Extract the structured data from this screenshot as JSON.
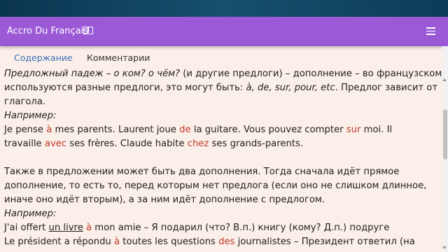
{
  "app": {
    "title": "Accro Du Français"
  },
  "tabs": [
    {
      "label": "Содержание"
    },
    {
      "label": "Комментарии"
    }
  ],
  "content": {
    "p1_a": "Предложный падеж – о ком? о чём?",
    "p1_b": " (и другие предлоги) – дополнение – во французском",
    "p2_a": "используются разные предлоги, это могут быть: ",
    "p2_b": "à, de, sur, pour, etc",
    "p2_c": ". Предлог зависит от",
    "p3": "глагола.",
    "example1": "Например:",
    "ex1_1": "Je pense ",
    "ex1_2": "à",
    "ex1_3": " mes parents. Laurent joue ",
    "ex1_4": "de",
    "ex1_5": " la guitare. Vous pouvez compter ",
    "ex1_6": "sur",
    "ex1_7": " moi. Il",
    "ex2_1": "travaille ",
    "ex2_2": "avec",
    "ex2_3": " ses frères. Claude habite ",
    "ex2_4": "chez",
    "ex2_5": " ses grands-parents.",
    "p4": "Также в предложении может быть два дополнения. Тогда сначала идёт прямое",
    "p5": "дополнение, то есть то, перед которым нет предлога (если оно не слишком длинное,",
    "p6": "иначе оно идёт вторым), а за ним идёт дополнение с предлогом.",
    "example2": "Например:",
    "ex3_1": "J'ai offert ",
    "ex3_2": "un livre",
    "ex3_3": " ",
    "ex3_4": "à",
    "ex3_5": " mon amie – Я подарил (что? В.п.) книгу (кому? Д.п.) подруге",
    "ex4_1": "Le président a répondu ",
    "ex4_2": "à",
    "ex4_3": " toutes les questions ",
    "ex4_4": "des",
    "ex4_5": " journalistes – Президент ответил (на"
  },
  "icons": {
    "title_icon": "book-icon",
    "menu_icon": "hamburger-menu-icon"
  },
  "colors": {
    "appbar": "#9b59d6",
    "background": "#fbefe9",
    "highlight": "#c0392b",
    "active_tab": "#3c6fb6"
  }
}
